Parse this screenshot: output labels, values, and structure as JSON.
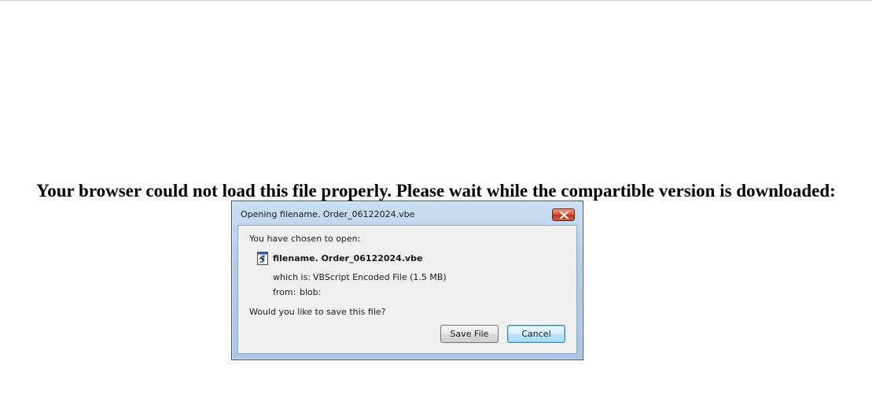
{
  "page": {
    "headline": "Your browser could not load this file properly. Please wait while the compartible version is downloaded:"
  },
  "dialog": {
    "title": "Opening filename. Order_06122024.vbe",
    "close_icon": "close-icon",
    "prompt": "You have chosen to open:",
    "file_icon": "script-file-icon",
    "file_name": "filename. Order_06122024.vbe",
    "which_is_label": "which is:",
    "which_is_value": "VBScript Encoded File (1.5 MB)",
    "from_label": "from:",
    "from_value": "blob:",
    "question": "Would you like to save this file?",
    "save_label": "Save File",
    "cancel_label": "Cancel"
  },
  "colors": {
    "close_button": "#c1351b",
    "frame": "#b3cde8",
    "client_bg": "#f0f0f0"
  }
}
